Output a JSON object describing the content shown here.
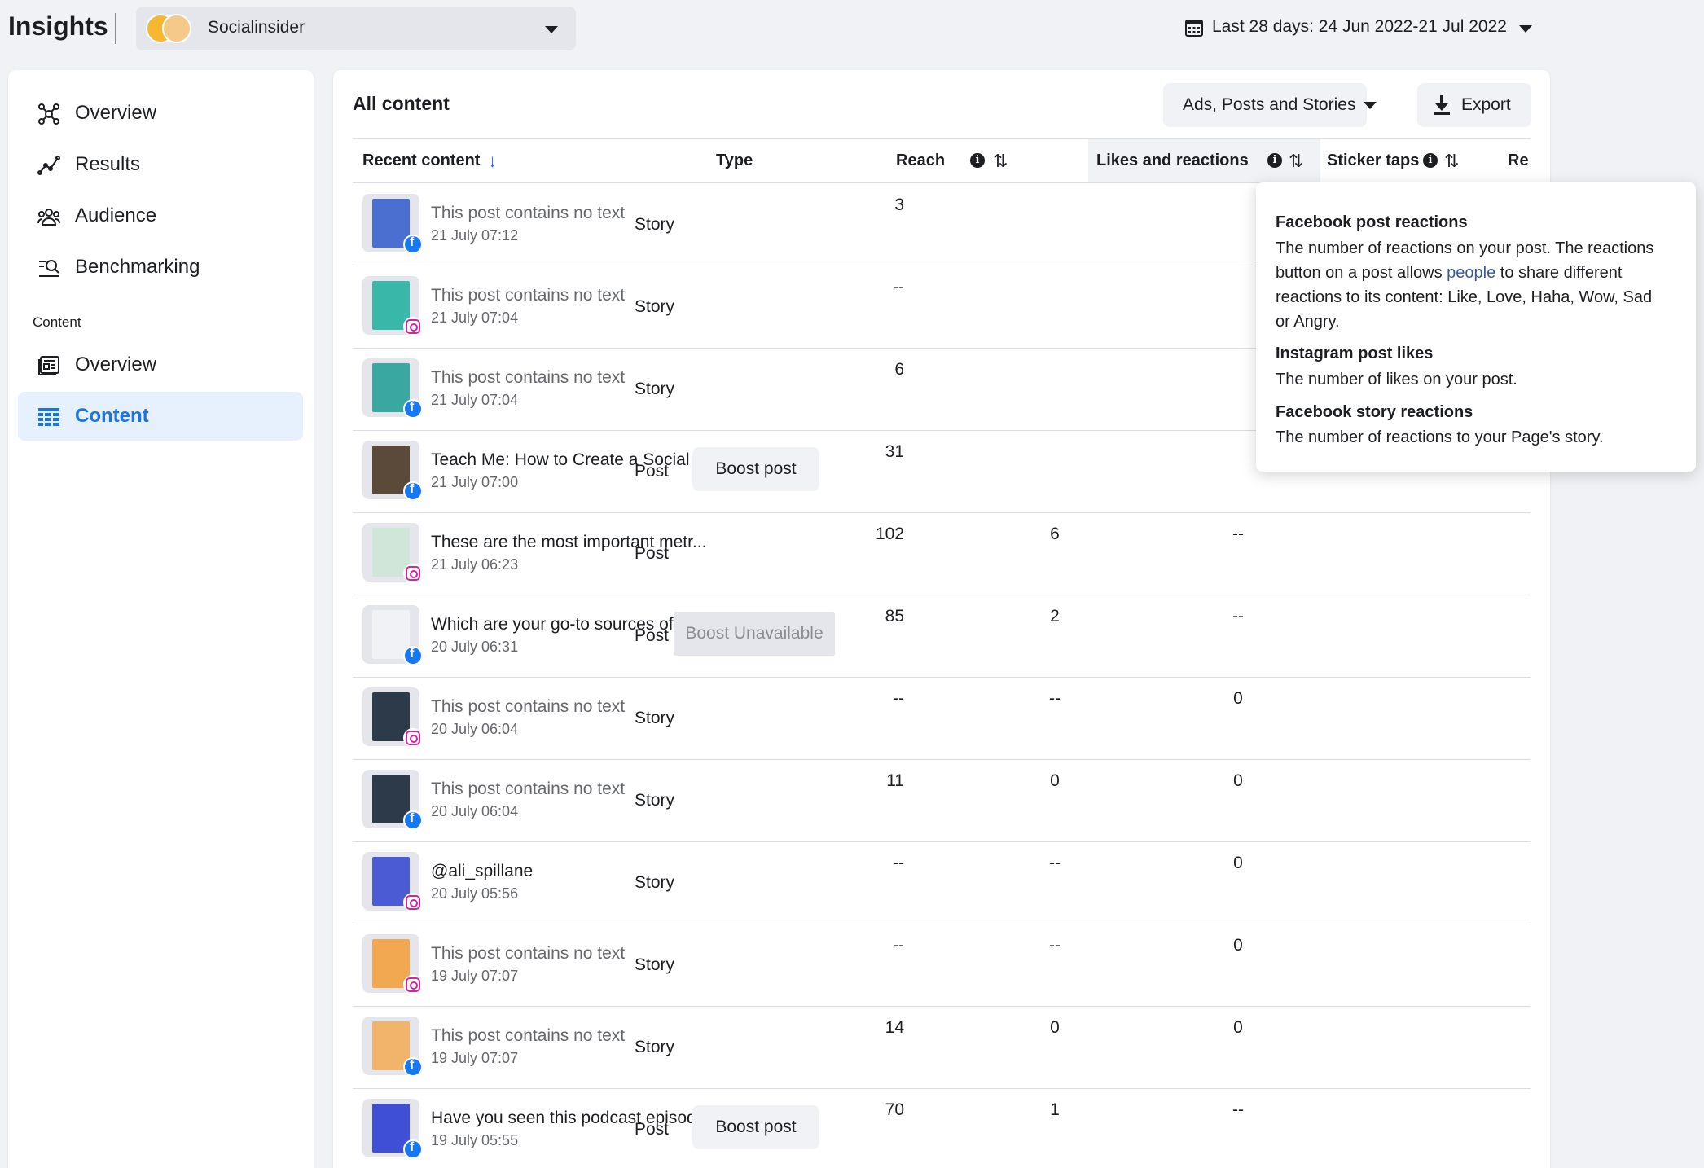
{
  "app_title": "Insights",
  "account": {
    "name": "Socialinsider"
  },
  "date_range": "Last 28 days: 24 Jun 2022-21 Jul 2022",
  "sidebar": {
    "items": [
      {
        "label": "Overview",
        "icon": "network-icon"
      },
      {
        "label": "Results",
        "icon": "trend-line-icon"
      },
      {
        "label": "Audience",
        "icon": "people-icon"
      },
      {
        "label": "Benchmarking",
        "icon": "benchmark-search-icon"
      }
    ],
    "section_label": "Content",
    "content_items": [
      {
        "label": "Overview",
        "icon": "content-overview-icon"
      },
      {
        "label": "Content",
        "icon": "table-grid-icon",
        "active": true
      }
    ]
  },
  "main": {
    "title": "All content",
    "filter_label": "Ads, Posts and Stories",
    "export_label": "Export"
  },
  "table": {
    "headers": {
      "recent": "Recent content",
      "type": "Type",
      "reach": "Reach",
      "likes": "Likes and reactions",
      "stickers": "Sticker taps",
      "next": "Re"
    },
    "rows": [
      {
        "text": "This post contains no text",
        "date": "21 July 07:12",
        "type": "Story",
        "boost": "",
        "reach": "3",
        "likes": "",
        "stickers": "",
        "platform": "facebook",
        "thumb_color": "#4a6fd1"
      },
      {
        "text": "This post contains no text",
        "date": "21 July 07:04",
        "type": "Story",
        "boost": "",
        "reach": "--",
        "likes": "",
        "stickers": "",
        "platform": "instagram",
        "thumb_color": "#39b7a8"
      },
      {
        "text": "This post contains no text",
        "date": "21 July 07:04",
        "type": "Story",
        "boost": "",
        "reach": "6",
        "likes": "",
        "stickers": "",
        "platform": "facebook",
        "thumb_color": "#3aa7a0"
      },
      {
        "text": "Teach Me: How to Create a Social ...",
        "date": "21 July 07:00",
        "type": "Post",
        "boost": "Boost post",
        "reach": "31",
        "likes": "",
        "stickers": "",
        "platform": "facebook",
        "thumb_color": "#5b4a3a"
      },
      {
        "text": "These are the most important metr...",
        "date": "21 July 06:23",
        "type": "Post",
        "boost": "",
        "reach": "102",
        "likes": "6",
        "stickers": "--",
        "platform": "instagram",
        "thumb_color": "#cfe6d8"
      },
      {
        "text": "Which are your go-to sources of in...",
        "date": "20 July 06:31",
        "type": "Post",
        "boost": "Boost Unavailable",
        "reach": "85",
        "likes": "2",
        "stickers": "--",
        "platform": "facebook",
        "thumb_color": "#f0f2f5"
      },
      {
        "text": "This post contains no text",
        "date": "20 July 06:04",
        "type": "Story",
        "boost": "",
        "reach": "--",
        "likes": "--",
        "stickers": "0",
        "platform": "instagram",
        "thumb_color": "#2c3a4a"
      },
      {
        "text": "This post contains no text",
        "date": "20 July 06:04",
        "type": "Story",
        "boost": "",
        "reach": "11",
        "likes": "0",
        "stickers": "0",
        "platform": "facebook",
        "thumb_color": "#2c3a4a"
      },
      {
        "text": "@ali_spillane",
        "date": "20 July 05:56",
        "type": "Story",
        "boost": "",
        "reach": "--",
        "likes": "--",
        "stickers": "0",
        "platform": "instagram",
        "thumb_color": "#4a5bd4"
      },
      {
        "text": "This post contains no text",
        "date": "19 July 07:07",
        "type": "Story",
        "boost": "",
        "reach": "--",
        "likes": "--",
        "stickers": "0",
        "platform": "instagram",
        "thumb_color": "#f2a850"
      },
      {
        "text": "This post contains no text",
        "date": "19 July 07:07",
        "type": "Story",
        "boost": "",
        "reach": "14",
        "likes": "0",
        "stickers": "0",
        "platform": "facebook",
        "thumb_color": "#f2b36a"
      },
      {
        "text": "Have you seen this podcast episod...",
        "date": "19 July 05:55",
        "type": "Post",
        "boost": "Boost post",
        "reach": "70",
        "likes": "1",
        "stickers": "--",
        "platform": "facebook",
        "thumb_color": "#3f4fd6"
      }
    ]
  },
  "tooltip": {
    "fb_reactions_title": "Facebook post reactions",
    "fb_reactions_text_1": "The number of reactions on your post. The reactions",
    "fb_reactions_text_2a": "button on a post allows ",
    "fb_reactions_link": "people",
    "fb_reactions_text_2b": " to share different",
    "fb_reactions_text_3": "reactions to its content: Like, Love, Haha, Wow, Sad",
    "fb_reactions_text_4": "or Angry.",
    "ig_likes_title": "Instagram post likes",
    "ig_likes_text": "The number of likes on your post.",
    "fb_story_title": "Facebook story reactions",
    "fb_story_text": "The number of reactions to your Page's story."
  }
}
